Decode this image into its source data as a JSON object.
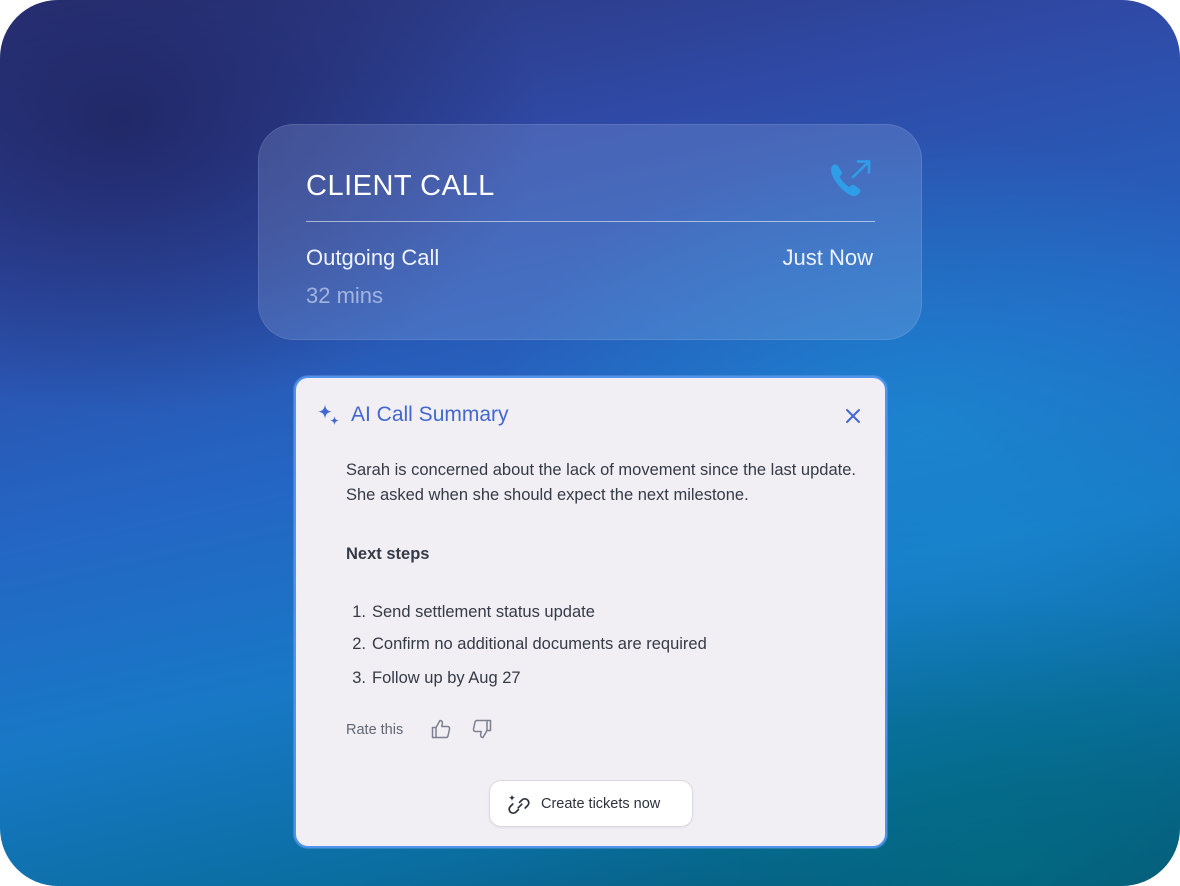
{
  "call_card": {
    "title": "CLIENT CALL",
    "icon": "outgoing-phone-icon",
    "type": "Outgoing Call",
    "time": "Just Now",
    "duration": "32 mins"
  },
  "summary": {
    "title": "AI Call Summary",
    "title_icon": "sparkle-icon",
    "close_icon": "close-icon",
    "body": "Sarah is concerned about the lack of movement since the last update. She asked when she should expect the next milestone.",
    "next_steps_heading": "Next steps",
    "steps": [
      {
        "num": "1.",
        "text": "Send settlement status update"
      },
      {
        "num": "2.",
        "text": "Confirm no additional documents are required"
      },
      {
        "num": "3.",
        "text": "Follow up by Aug 27"
      }
    ],
    "rate_label": "Rate this",
    "rate_icons": [
      "thumbs-up-icon",
      "thumbs-down-icon"
    ],
    "create_button_label": "Create tickets now",
    "create_button_icon": "magic-link-icon"
  },
  "colors": {
    "accent_blue": "#4267cf",
    "panel_border": "#4f93ec",
    "phone_icon": "#2f9ee8",
    "panel_background": "#f1eff4"
  }
}
